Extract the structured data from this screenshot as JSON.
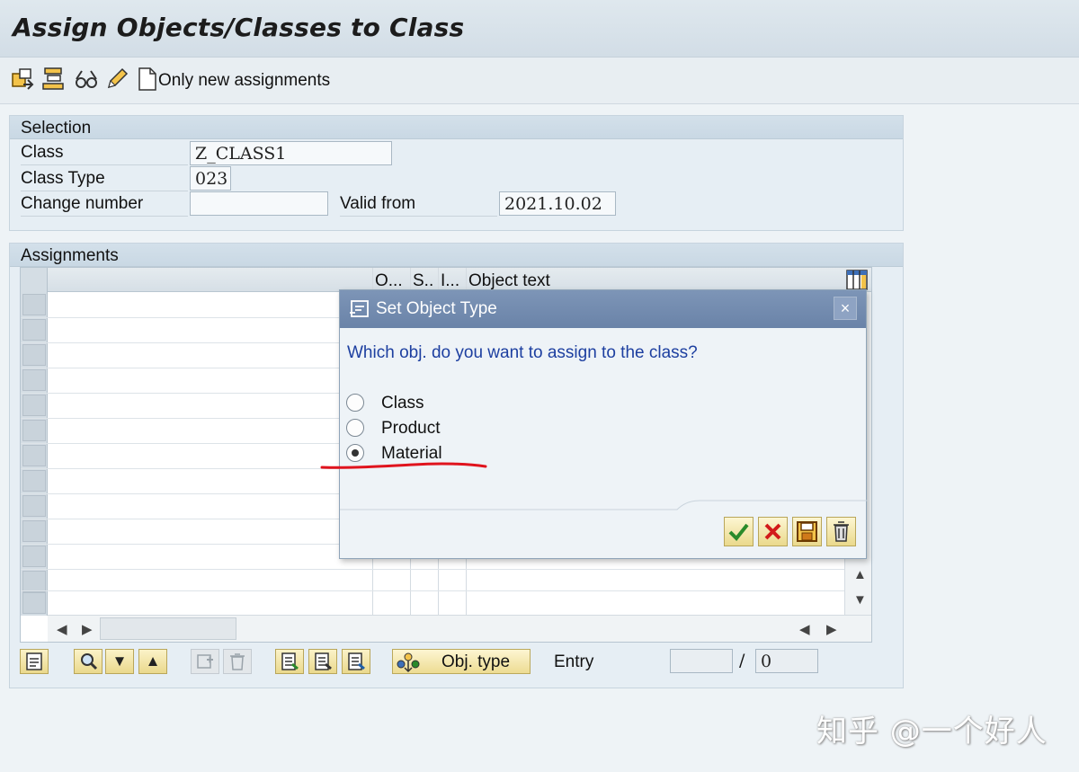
{
  "title": "Assign Objects/Classes to Class",
  "toolbar": {
    "only_new_label": "Only new assignments",
    "icons": [
      "new-entries-icon",
      "hierarchy-icon",
      "display-change-glasses-icon",
      "pencil-icon",
      "blank-document-icon"
    ]
  },
  "selection": {
    "header": "Selection",
    "class_label": "Class",
    "class_value": "Z_CLASS1",
    "class_type_label": "Class Type",
    "class_type_value": "023",
    "change_number_label": "Change number",
    "change_number_value": "",
    "valid_from_label": "Valid from",
    "valid_from_value": "2021.10.02"
  },
  "assignments": {
    "header": "Assignments",
    "columns": [
      "O...",
      "S..",
      "I...",
      "Object text"
    ],
    "entry_label": "Entry",
    "entry_value": "",
    "entry_separator": "/",
    "entry_total": "0",
    "obj_type_label": "Obj. type"
  },
  "dialog": {
    "title": "Set Object Type",
    "question": "Which obj. do you want to assign to the class?",
    "options": [
      "Class",
      "Product",
      "Material"
    ],
    "selected": "Material",
    "close_glyph": "×"
  },
  "colors": {
    "dialog_title_bg": "#6a83a8",
    "question_text": "#1d3fa0",
    "annotation_red": "#e0131d"
  }
}
